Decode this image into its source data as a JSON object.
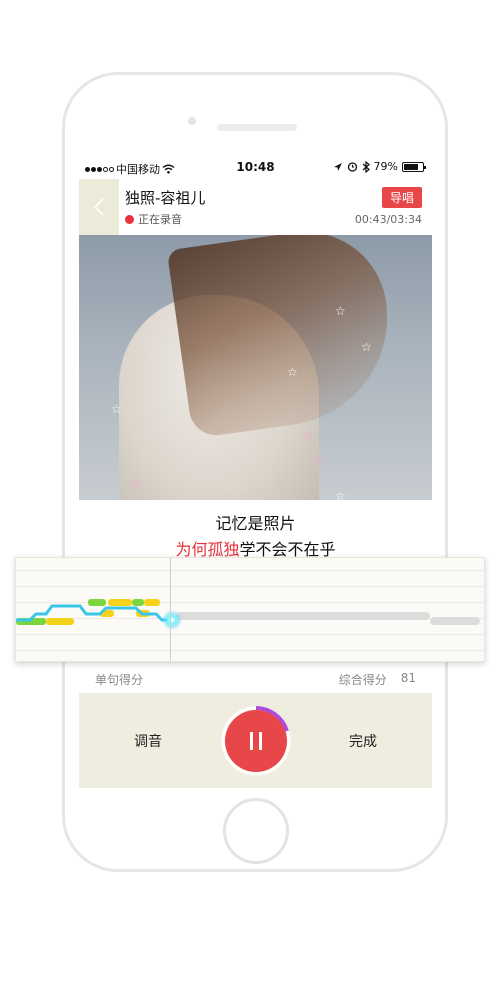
{
  "status_bar": {
    "carrier": "中国移动",
    "time": "10:48",
    "battery": "79%",
    "battery_level": 0.79
  },
  "header": {
    "song_title": "独照-容祖儿",
    "recording_status": "正在录音",
    "guide_label": "导唱",
    "progress_time": "00:43/03:34"
  },
  "lyrics": {
    "line1": "记忆是照片",
    "line2_sung": "为何孤独",
    "line2_rest": "学不会不在乎"
  },
  "score": {
    "sentence_label": "单句得分",
    "overall_label": "综合得分",
    "overall_value": "81"
  },
  "controls": {
    "tune_label": "调音",
    "done_label": "完成"
  },
  "colors": {
    "accent_red": "#e8474a",
    "control_bg": "#efede0",
    "pitch_cyan": "#3ac6e8",
    "pitch_yellow": "#f5d31a",
    "pitch_green": "#7ad63c"
  }
}
